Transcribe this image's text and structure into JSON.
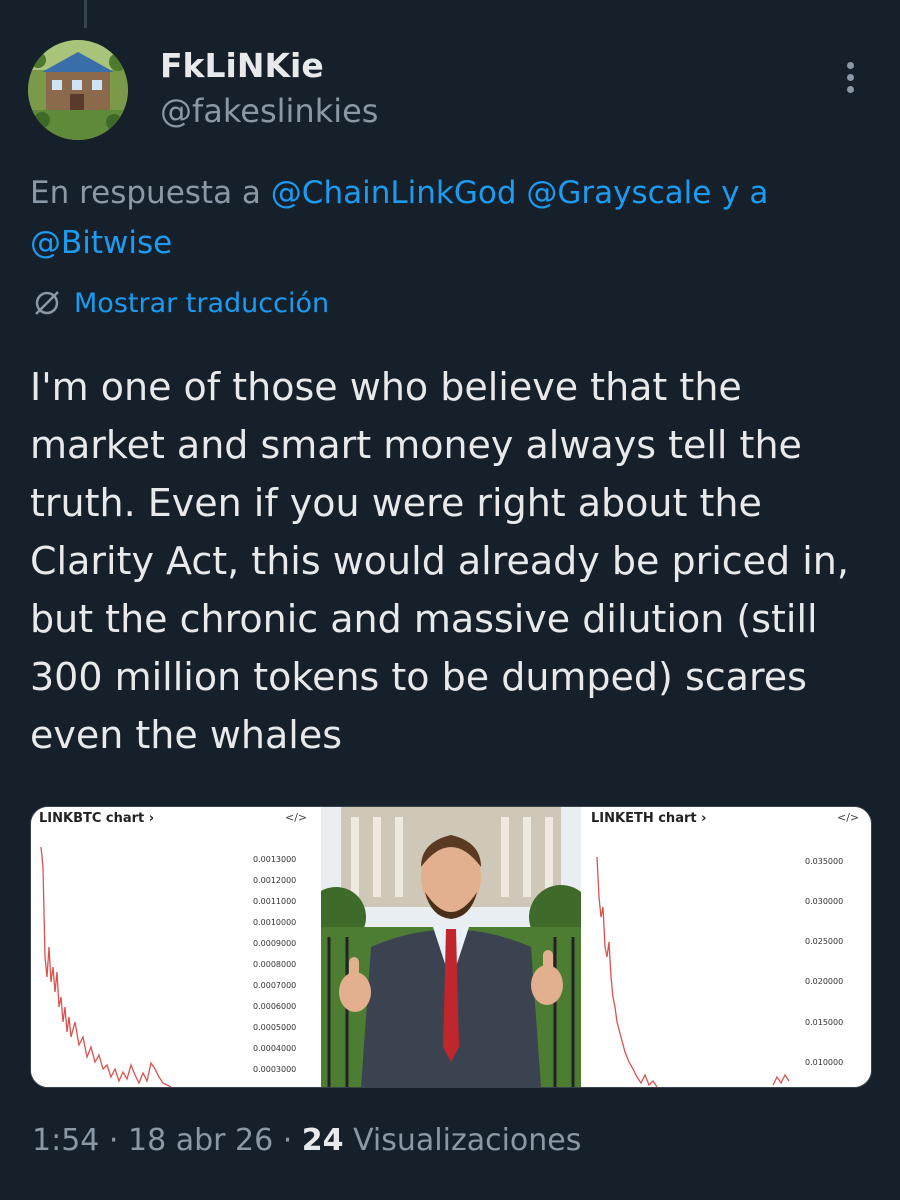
{
  "author": {
    "display_name": "FkLiNKie",
    "handle": "@fakeslinkies"
  },
  "reply": {
    "prefix": "En respuesta a",
    "mention_1": "@ChainLinkGod",
    "mention_2": "@Grayscale",
    "joiner": "y a",
    "mention_3": "@Bitwise"
  },
  "translate_label": "Mostrar traducción",
  "tweet_text": "I'm one of those who believe that the market and smart money always tell the truth. Even if you were right about the Clarity Act, this would already be priced in, but the chronic and massive dilution (still 300 million tokens to be dumped) scares even the whales",
  "media": {
    "left_chart": {
      "title": "LINKBTC chart ›",
      "code_icon": "</>",
      "ticks": [
        "0.0013000",
        "0.0012000",
        "0.0011000",
        "0.0010000",
        "0.0009000",
        "0.0008000",
        "0.0007000",
        "0.0006000",
        "0.0005000",
        "0.0004000",
        "0.0003000"
      ]
    },
    "right_chart": {
      "title": "LINKETH chart ›",
      "code_icon": "</>",
      "ticks": [
        "0.035000",
        "0.030000",
        "0.025000",
        "0.020000",
        "0.015000",
        "0.010000"
      ]
    },
    "photo": "man-in-suit-thumbs-up"
  },
  "meta": {
    "time": "1:54",
    "sep1": " · ",
    "date": "18 abr 26",
    "sep2": " · ",
    "views_count": "24",
    "views_label": " Visualizaciones"
  },
  "icons": {
    "more": "more-vertical-icon",
    "translate": "globe-slash-icon"
  },
  "colors": {
    "background": "#15202b",
    "link": "#1d9bf0",
    "secondary_text": "#8b98a5",
    "chart_line": "#d9534f"
  }
}
